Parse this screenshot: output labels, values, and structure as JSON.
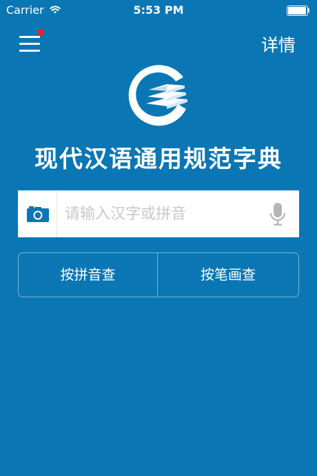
{
  "status_bar": {
    "carrier": "Carrier",
    "time": "5:53 PM"
  },
  "header": {
    "details_label": "详情",
    "has_notification": true
  },
  "app": {
    "title": "现代汉语通用规范字典"
  },
  "search": {
    "placeholder": "请输入汉字或拼音",
    "value": ""
  },
  "lookup_buttons": {
    "pinyin_label": "按拼音查",
    "stroke_label": "按笔画查"
  },
  "icons": {
    "menu": "hamburger-icon",
    "camera": "camera-icon",
    "mic": "microphone-icon",
    "wifi": "wifi-icon",
    "battery": "battery-icon",
    "logo": "book-logo-icon"
  },
  "colors": {
    "background": "#0b76b4",
    "notification_dot": "#e8232a",
    "search_bar": "#ffffff",
    "placeholder": "#c8c8c8",
    "icon_blue": "#0b76b4",
    "mic_gray": "#b5b5b5"
  }
}
